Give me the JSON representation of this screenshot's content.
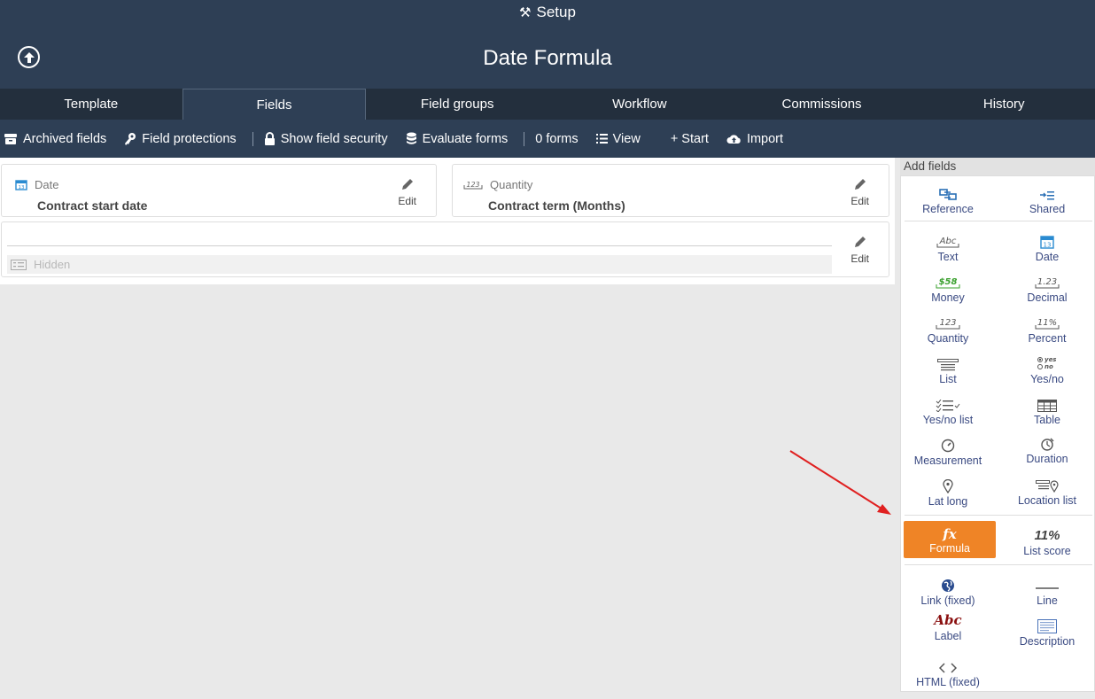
{
  "header": {
    "setup_label": "Setup",
    "title": "Date Formula"
  },
  "tabs": [
    {
      "label": "Template"
    },
    {
      "label": "Fields"
    },
    {
      "label": "Field groups"
    },
    {
      "label": "Workflow"
    },
    {
      "label": "Commissions"
    },
    {
      "label": "History"
    }
  ],
  "toolbar": {
    "archived": "Archived fields",
    "protections": "Field protections",
    "security": "Show field security",
    "evaluate": "Evaluate forms",
    "forms_count": "0 forms",
    "view": "View",
    "start": "+ Start",
    "import": "Import"
  },
  "fields": [
    {
      "type": "Date",
      "name": "Contract start date",
      "edit": "Edit"
    },
    {
      "type": "Quantity",
      "name": "Contract term (Months)",
      "edit": "Edit"
    },
    {
      "hidden_label": "Hidden",
      "edit": "Edit"
    }
  ],
  "panel": {
    "title": "Add fields",
    "items": {
      "reference": "Reference",
      "shared": "Shared",
      "text": "Text",
      "date": "Date",
      "money": "Money",
      "decimal": "Decimal",
      "quantity": "Quantity",
      "percent": "Percent",
      "list": "List",
      "yesno": "Yes/no",
      "yesnolist": "Yes/no list",
      "table": "Table",
      "measurement": "Measurement",
      "duration": "Duration",
      "latlong": "Lat long",
      "locationlist": "Location list",
      "formula": "Formula",
      "listscore": "List score",
      "link": "Link (fixed)",
      "line": "Line",
      "label": "Label",
      "description": "Description",
      "html": "HTML (fixed)"
    },
    "icon_text": {
      "text": "Abc",
      "money": "$58",
      "decimal": "1.23",
      "quantity": "123",
      "percent": "11%",
      "formula": "fx",
      "listscore": "11%",
      "label": "Abc",
      "yes": "yes",
      "no": "no"
    }
  },
  "colors": {
    "header_bg": "#2e3f55",
    "tab_bg": "#232f3d",
    "accent": "#ef8426",
    "link": "#3a4a82",
    "arrow": "#e02020"
  }
}
